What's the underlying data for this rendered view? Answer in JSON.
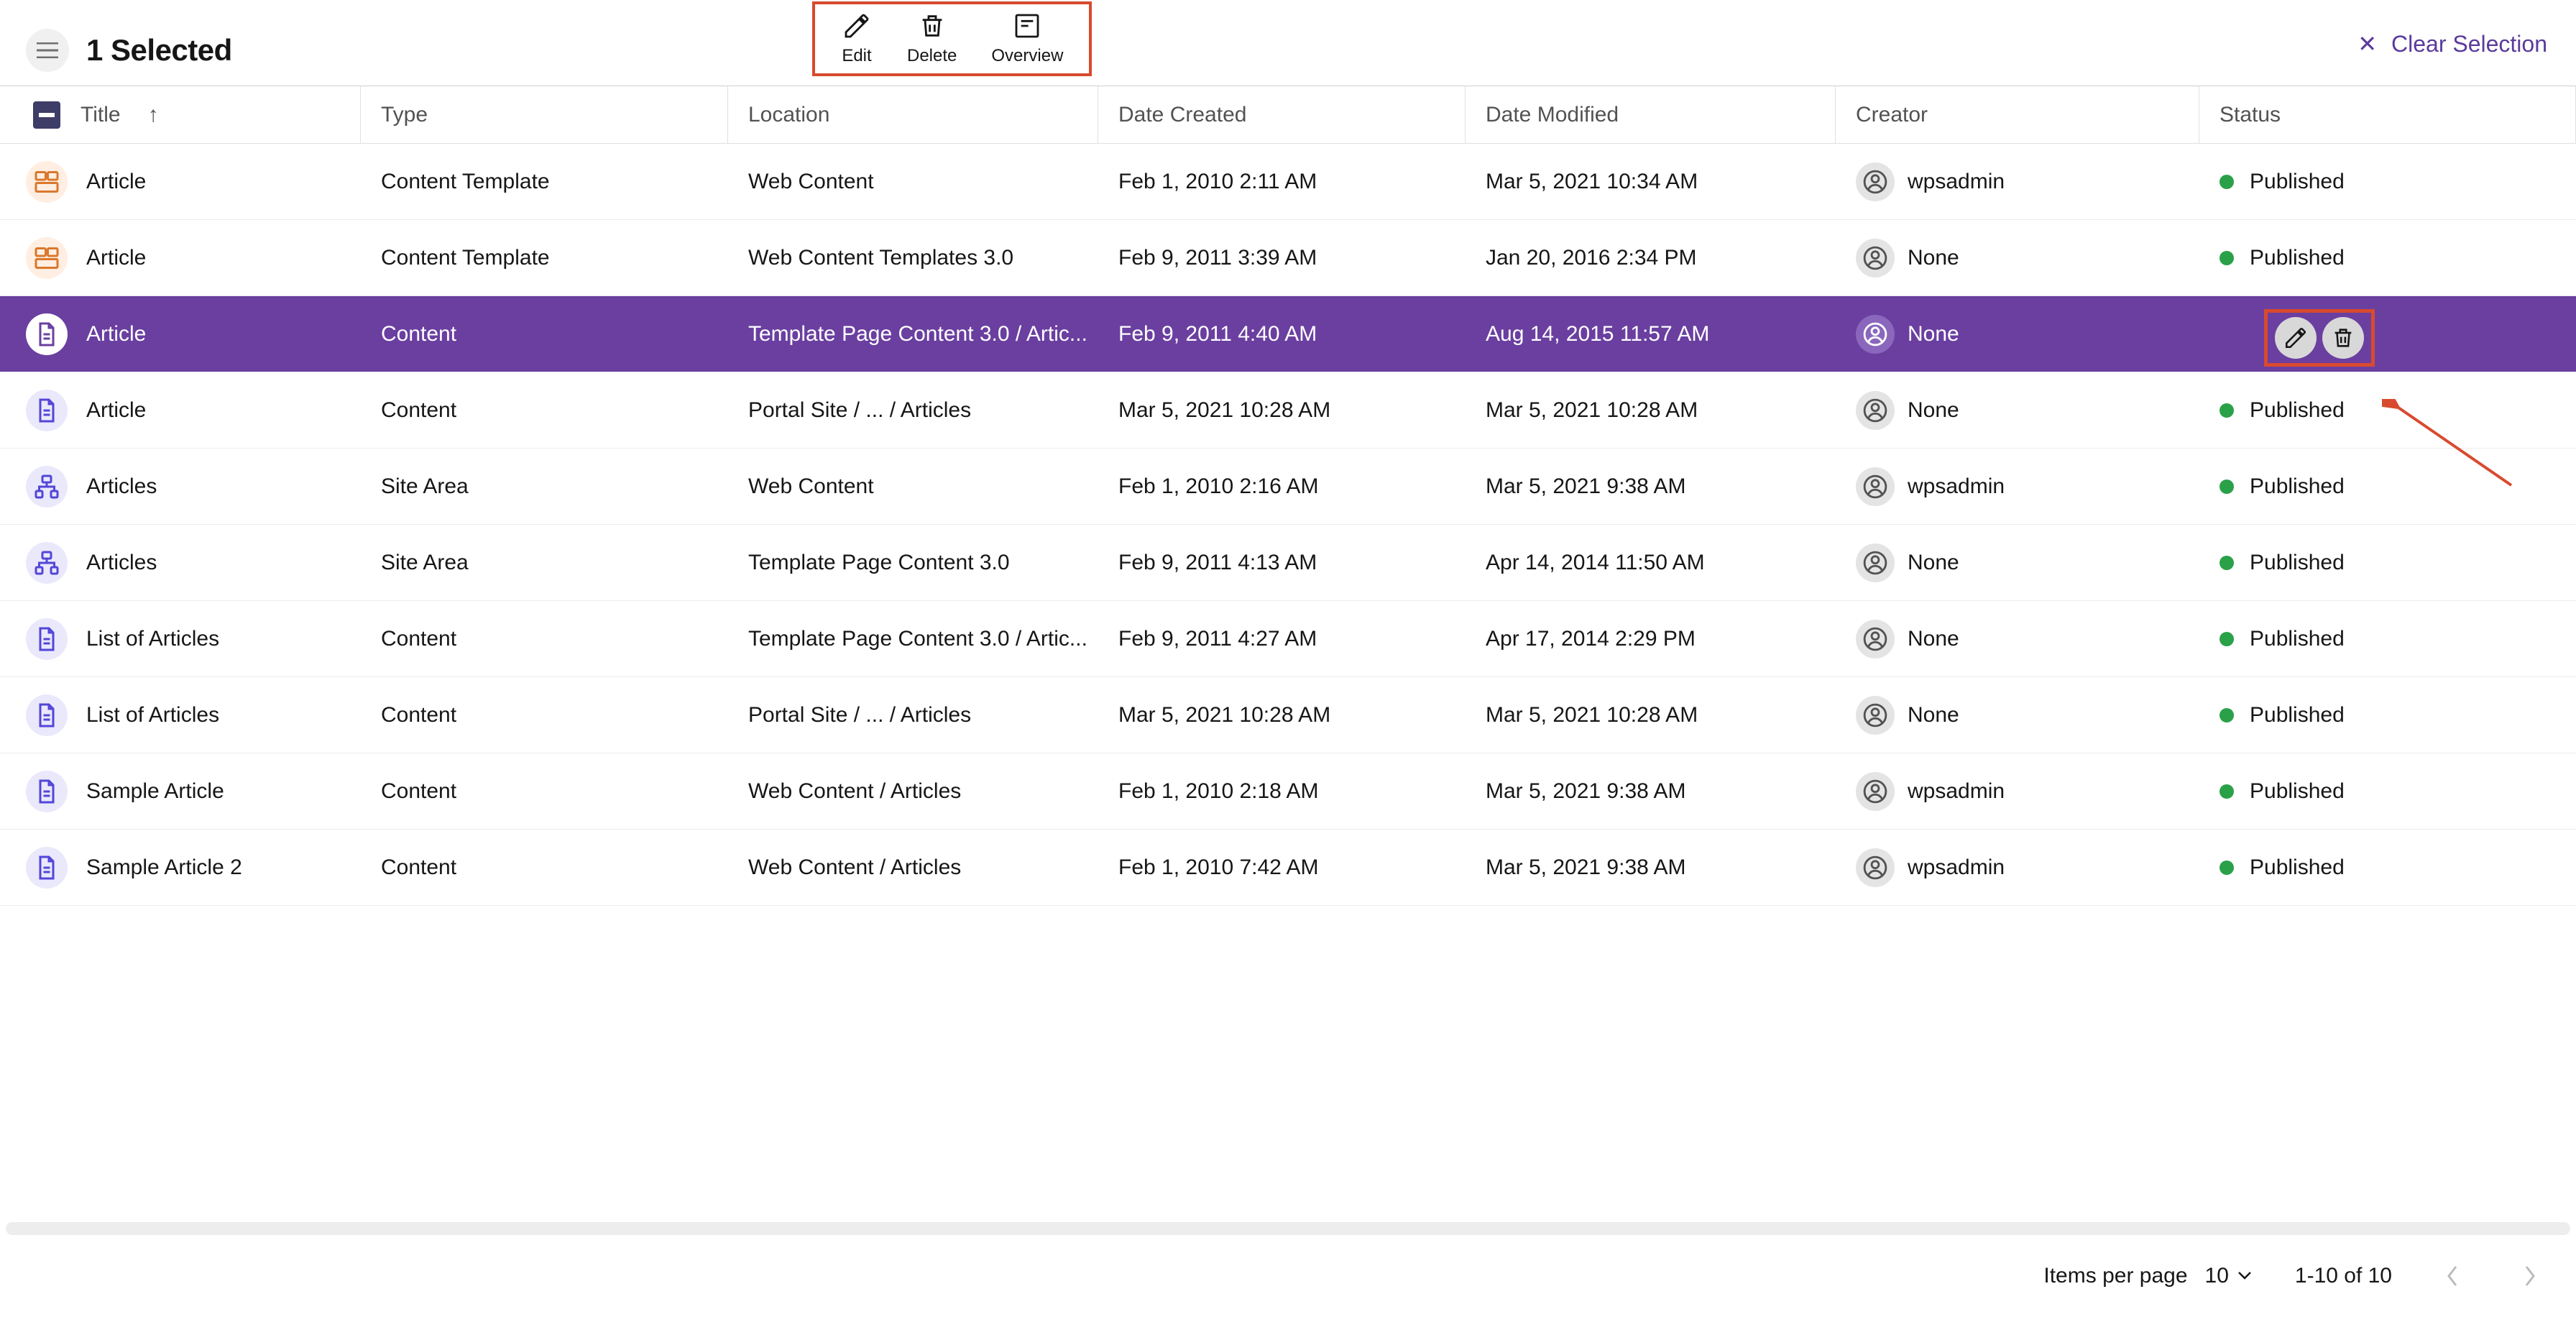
{
  "selection_bar": {
    "count_text": "1 Selected",
    "actions": {
      "edit": "Edit",
      "delete": "Delete",
      "overview": "Overview"
    },
    "clear": "Clear Selection"
  },
  "columns": {
    "title": "Title",
    "type": "Type",
    "location": "Location",
    "date_created": "Date Created",
    "date_modified": "Date Modified",
    "creator": "Creator",
    "status": "Status",
    "sort_indicator": "↑"
  },
  "rows": [
    {
      "icon_type": "content-template",
      "title": "Article",
      "type": "Content Template",
      "location": "Web Content",
      "date_created": "Feb 1, 2010 2:11 AM",
      "date_modified": "Mar 5, 2021 10:34 AM",
      "creator": "wpsadmin",
      "status": "Published",
      "selected": false
    },
    {
      "icon_type": "content-template",
      "title": "Article",
      "type": "Content Template",
      "location": "Web Content Templates 3.0",
      "date_created": "Feb 9, 2011 3:39 AM",
      "date_modified": "Jan 20, 2016 2:34 PM",
      "creator": "None",
      "status": "Published",
      "selected": false
    },
    {
      "icon_type": "content",
      "title": "Article",
      "type": "Content",
      "location": "Template Page Content 3.0 / Artic...",
      "date_created": "Feb 9, 2011 4:40 AM",
      "date_modified": "Aug 14, 2015 11:57 AM",
      "creator": "None",
      "status": "",
      "selected": true
    },
    {
      "icon_type": "content",
      "title": "Article",
      "type": "Content",
      "location": "Portal Site / ... / Articles",
      "date_created": "Mar 5, 2021 10:28 AM",
      "date_modified": "Mar 5, 2021 10:28 AM",
      "creator": "None",
      "status": "Published",
      "selected": false
    },
    {
      "icon_type": "site-area",
      "title": "Articles",
      "type": "Site Area",
      "location": "Web Content",
      "date_created": "Feb 1, 2010 2:16 AM",
      "date_modified": "Mar 5, 2021 9:38 AM",
      "creator": "wpsadmin",
      "status": "Published",
      "selected": false
    },
    {
      "icon_type": "site-area",
      "title": "Articles",
      "type": "Site Area",
      "location": "Template Page Content 3.0",
      "date_created": "Feb 9, 2011 4:13 AM",
      "date_modified": "Apr 14, 2014 11:50 AM",
      "creator": "None",
      "status": "Published",
      "selected": false
    },
    {
      "icon_type": "content",
      "title": "List of Articles",
      "type": "Content",
      "location": "Template Page Content 3.0 / Artic...",
      "date_created": "Feb 9, 2011 4:27 AM",
      "date_modified": "Apr 17, 2014 2:29 PM",
      "creator": "None",
      "status": "Published",
      "selected": false
    },
    {
      "icon_type": "content",
      "title": "List of Articles",
      "type": "Content",
      "location": "Portal Site / ... / Articles",
      "date_created": "Mar 5, 2021 10:28 AM",
      "date_modified": "Mar 5, 2021 10:28 AM",
      "creator": "None",
      "status": "Published",
      "selected": false
    },
    {
      "icon_type": "content",
      "title": "Sample Article",
      "type": "Content",
      "location": "Web Content / Articles",
      "date_created": "Feb 1, 2010 2:18 AM",
      "date_modified": "Mar 5, 2021 9:38 AM",
      "creator": "wpsadmin",
      "status": "Published",
      "selected": false
    },
    {
      "icon_type": "content",
      "title": "Sample Article 2",
      "type": "Content",
      "location": "Web Content / Articles",
      "date_created": "Feb 1, 2010 7:42 AM",
      "date_modified": "Mar 5, 2021 9:38 AM",
      "creator": "wpsadmin",
      "status": "Published",
      "selected": false
    }
  ],
  "footer": {
    "items_per_page_label": "Items per page",
    "items_per_page_value": "10",
    "range_text": "1-10 of 10"
  },
  "colors": {
    "selected_row": "#6a3fa0",
    "accent_link": "#5b3b9c",
    "status_green": "#2aa148",
    "annotation_red": "#d84a2f"
  }
}
